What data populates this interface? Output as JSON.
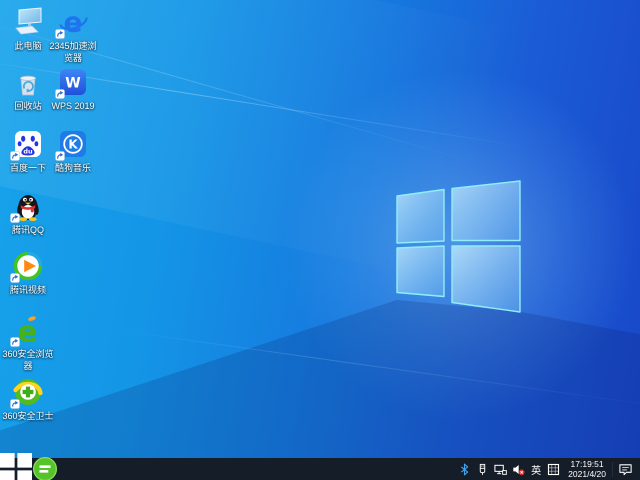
{
  "wallpaper": {
    "gradient_left": "#17a4eb",
    "gradient_right": "#1847c8",
    "logo_pane_border": "#8feef9"
  },
  "desktop": {
    "icons": [
      {
        "name": "desktop-icon-this-pc",
        "icon": "monitor-icon",
        "label": "此电脑",
        "lines": [
          "此电脑"
        ],
        "shortcut": false,
        "col": 1,
        "row": 1
      },
      {
        "name": "desktop-icon-2345-browser",
        "icon": "blue-e-browser-icon",
        "label": "2345加速浏览器",
        "lines": [
          "2345加速浏",
          "览器"
        ],
        "shortcut": true,
        "col": 2,
        "row": 1
      },
      {
        "name": "desktop-icon-recycle-bin",
        "icon": "recycle-bin-icon",
        "label": "回收站",
        "lines": [
          "回收站"
        ],
        "shortcut": false,
        "col": 1,
        "row": 2
      },
      {
        "name": "desktop-icon-wps-2019",
        "icon": "wps-icon",
        "label": "WPS 2019",
        "lines": [
          "WPS 2019"
        ],
        "shortcut": true,
        "col": 2,
        "row": 2
      },
      {
        "name": "desktop-icon-baidu",
        "icon": "baidu-paw-icon",
        "label": "百度一下",
        "lines": [
          "百度一下"
        ],
        "shortcut": true,
        "col": 1,
        "row": 3
      },
      {
        "name": "desktop-icon-kugou-music",
        "icon": "kugou-k-icon",
        "label": "酷狗音乐",
        "lines": [
          "酷狗音乐"
        ],
        "shortcut": true,
        "col": 2,
        "row": 3
      },
      {
        "name": "desktop-icon-tencent-qq",
        "icon": "qq-penguin-icon",
        "label": "腾讯QQ",
        "lines": [
          "腾讯QQ"
        ],
        "shortcut": true,
        "col": 1,
        "row": 4
      },
      {
        "name": "desktop-icon-tencent-video",
        "icon": "tencent-video-icon",
        "label": "腾讯视频",
        "lines": [
          "腾讯视频"
        ],
        "shortcut": true,
        "col": 1,
        "row": 5
      },
      {
        "name": "desktop-icon-360-browser",
        "icon": "green-e-browser-icon",
        "label": "360安全浏览器",
        "lines": [
          "360安全浏览",
          "器"
        ],
        "shortcut": true,
        "col": 1,
        "row": 6
      },
      {
        "name": "desktop-icon-360-safeguard",
        "icon": "360-safeguard-icon",
        "label": "360安全卫士",
        "lines": [
          "360安全卫士"
        ],
        "shortcut": true,
        "col": 1,
        "row": 7
      }
    ]
  },
  "taskbar": {
    "background": "#151d28",
    "pinned_app": {
      "name": "taskbar-360-browser-button",
      "icon": "green-circle-e-icon"
    },
    "tray": {
      "language_indicator": "英",
      "icons": [
        "bluetooth-icon",
        "usb-device-icon",
        "network-ethernet-icon",
        "volume-muted-icon",
        "ime-grid-icon"
      ]
    },
    "clock": {
      "time": "17:19:51",
      "date": "2021/4/20"
    }
  }
}
